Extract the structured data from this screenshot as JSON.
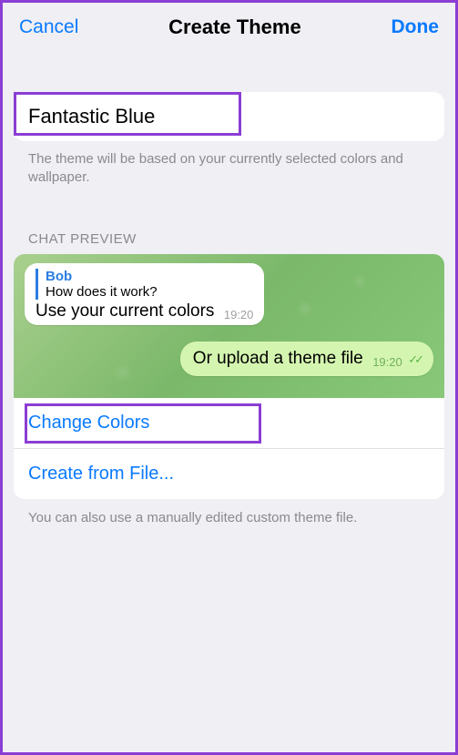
{
  "header": {
    "cancel": "Cancel",
    "title": "Create Theme",
    "done": "Done"
  },
  "theme_name": "Fantastic Blue",
  "name_hint": "The theme will be based on your currently selected colors and wallpaper.",
  "preview_label": "CHAT PREVIEW",
  "preview": {
    "reply_name": "Bob",
    "reply_text": "How does it work?",
    "in_msg": "Use your current colors",
    "in_time": "19:20",
    "out_msg": "Or upload a theme file",
    "out_time": "19:20"
  },
  "options": {
    "change_colors": "Change Colors",
    "create_from_file": "Create from File..."
  },
  "footer_hint": "You can also use a manually edited custom theme file."
}
